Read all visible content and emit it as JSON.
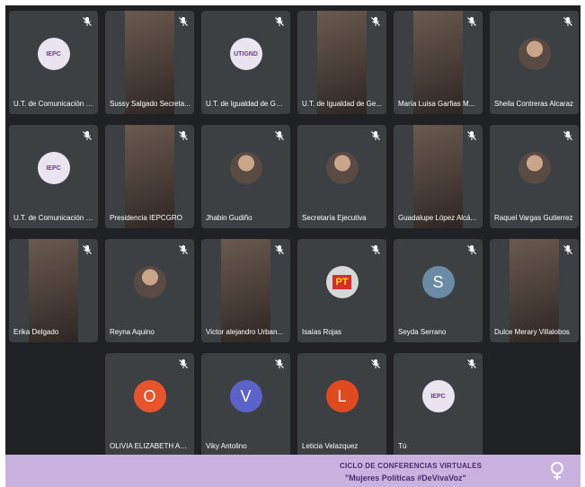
{
  "participants": [
    {
      "name": "U.T. de Comunicación S...",
      "kind": "logo",
      "logo": "IEPC"
    },
    {
      "name": "Sussy Salgado Secreta...",
      "kind": "video"
    },
    {
      "name": "U.T. de Igualdad de Gén...",
      "kind": "logo",
      "logo": "UTIGND"
    },
    {
      "name": "U.T. de Igualdad de Ge...",
      "kind": "video"
    },
    {
      "name": "María Luisa Garfias M...",
      "kind": "video"
    },
    {
      "name": "Sheila Contreras Alcaraz",
      "kind": "photo"
    },
    {
      "name": "U.T. de Comunicación S...",
      "kind": "logo",
      "logo": "IEPC"
    },
    {
      "name": "Presidencia IEPCGRO",
      "kind": "video"
    },
    {
      "name": "Jhabin Gudiño",
      "kind": "photo"
    },
    {
      "name": "Secretaría Ejecutiva",
      "kind": "photo"
    },
    {
      "name": "Guadalupe López Alcá...",
      "kind": "video"
    },
    {
      "name": "Raquel Vargas Gutierrez",
      "kind": "photo"
    },
    {
      "name": "Erika Delgado",
      "kind": "video"
    },
    {
      "name": "Reyna Aquino",
      "kind": "photo"
    },
    {
      "name": "Victor alejandro Urban...",
      "kind": "video"
    },
    {
      "name": "Isaías Rojas",
      "kind": "logo",
      "logo": "PT"
    },
    {
      "name": "Seyda Serrano",
      "kind": "initial",
      "initial": "S",
      "color": "#6b8ba4"
    },
    {
      "name": "Dulce Merary Villalobos",
      "kind": "video"
    },
    {
      "name": "OLIVIA ELIZABETH ALV...",
      "kind": "initial",
      "initial": "O",
      "color": "#e8542b"
    },
    {
      "name": "Viky Antolino",
      "kind": "initial",
      "initial": "V",
      "color": "#5b63c9"
    },
    {
      "name": "Leticia Velazquez",
      "kind": "initial",
      "initial": "L",
      "color": "#e04a1f"
    },
    {
      "name": "Tú",
      "kind": "logo",
      "logo": "IEPC"
    }
  ],
  "banner": {
    "line1": "CICLO DE CONFERENCIAS VIRTUALES",
    "line2": "\"Mujeres Políticas #DeVivaVoz\""
  }
}
